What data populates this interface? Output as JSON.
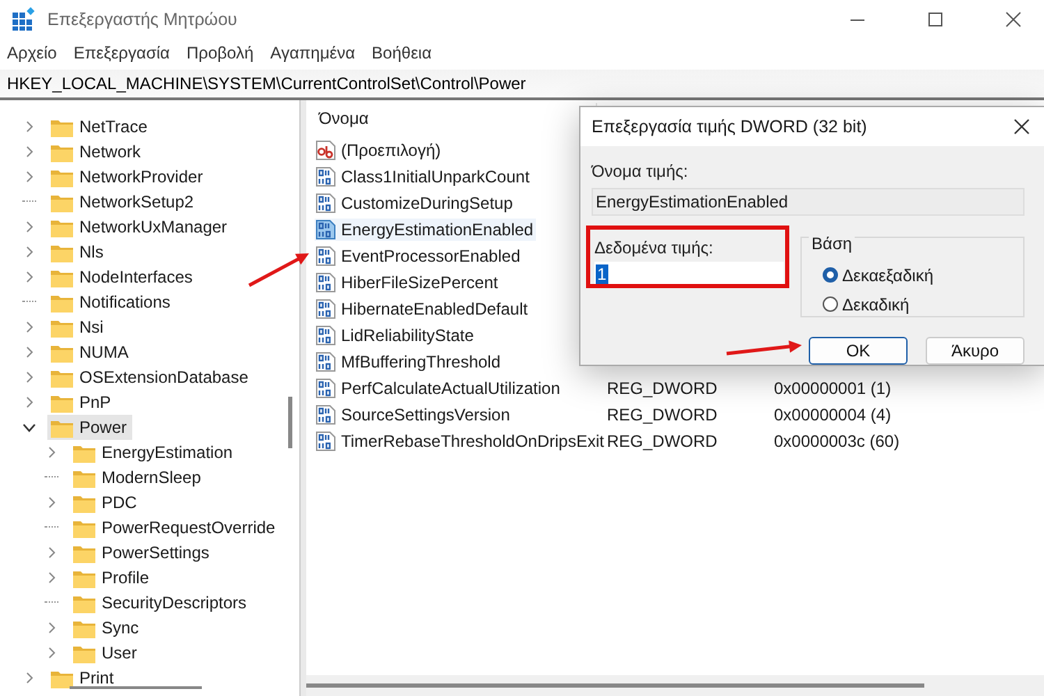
{
  "window": {
    "title": "Επεξεργαστής Μητρώου"
  },
  "menu": [
    "Αρχείο",
    "Επεξεργασία",
    "Προβολή",
    "Αγαπημένα",
    "Βοήθεια"
  ],
  "address": "HKEY_LOCAL_MACHINE\\SYSTEM\\CurrentControlSet\\Control\\Power",
  "tree": [
    {
      "label": "NetTrace",
      "has_children": true,
      "expanded": false,
      "selected": false
    },
    {
      "label": "Network",
      "has_children": true,
      "expanded": false,
      "selected": false
    },
    {
      "label": "NetworkProvider",
      "has_children": true,
      "expanded": false,
      "selected": false
    },
    {
      "label": "NetworkSetup2",
      "has_children": false,
      "selected": false
    },
    {
      "label": "NetworkUxManager",
      "has_children": true,
      "expanded": false,
      "selected": false
    },
    {
      "label": "Nls",
      "has_children": true,
      "expanded": false,
      "selected": false
    },
    {
      "label": "NodeInterfaces",
      "has_children": true,
      "expanded": false,
      "selected": false
    },
    {
      "label": "Notifications",
      "has_children": false,
      "selected": false
    },
    {
      "label": "Nsi",
      "has_children": true,
      "expanded": false,
      "selected": false
    },
    {
      "label": "NUMA",
      "has_children": true,
      "expanded": false,
      "selected": false
    },
    {
      "label": "OSExtensionDatabase",
      "has_children": true,
      "expanded": false,
      "selected": false
    },
    {
      "label": "PnP",
      "has_children": true,
      "expanded": false,
      "selected": false
    },
    {
      "label": "Power",
      "has_children": true,
      "expanded": true,
      "selected": true,
      "children": [
        {
          "label": "EnergyEstimation",
          "has_children": true,
          "expanded": false,
          "selected": false
        },
        {
          "label": "ModernSleep",
          "has_children": false,
          "selected": false
        },
        {
          "label": "PDC",
          "has_children": true,
          "expanded": false,
          "selected": false
        },
        {
          "label": "PowerRequestOverride",
          "has_children": false,
          "selected": false
        },
        {
          "label": "PowerSettings",
          "has_children": true,
          "expanded": false,
          "selected": false
        },
        {
          "label": "Profile",
          "has_children": true,
          "expanded": false,
          "selected": false
        },
        {
          "label": "SecurityDescriptors",
          "has_children": false,
          "selected": false
        },
        {
          "label": "Sync",
          "has_children": true,
          "expanded": false,
          "selected": false
        },
        {
          "label": "User",
          "has_children": true,
          "expanded": false,
          "selected": false
        }
      ]
    },
    {
      "label": "Print",
      "has_children": true,
      "expanded": false,
      "selected": false
    }
  ],
  "values": {
    "columns": [
      "Όνομα"
    ],
    "rows": [
      {
        "name": "(Προεπιλογή)",
        "kind": "string",
        "selected": false
      },
      {
        "name": "Class1InitialUnparkCount",
        "kind": "dword",
        "selected": false
      },
      {
        "name": "CustomizeDuringSetup",
        "kind": "dword",
        "selected": false
      },
      {
        "name": "EnergyEstimationEnabled",
        "kind": "dword",
        "selected": true
      },
      {
        "name": "EventProcessorEnabled",
        "kind": "dword",
        "selected": false
      },
      {
        "name": "HiberFileSizePercent",
        "kind": "dword",
        "selected": false
      },
      {
        "name": "HibernateEnabledDefault",
        "kind": "dword",
        "selected": false
      },
      {
        "name": "LidReliabilityState",
        "kind": "dword",
        "selected": false
      },
      {
        "name": "MfBufferingThreshold",
        "kind": "dword",
        "selected": false
      },
      {
        "name": "PerfCalculateActualUtilization",
        "kind": "dword",
        "selected": false,
        "type": "REG_DWORD",
        "data": "0x00000001 (1)"
      },
      {
        "name": "SourceSettingsVersion",
        "kind": "dword",
        "selected": false,
        "type": "REG_DWORD",
        "data": "0x00000004 (4)"
      },
      {
        "name": "TimerRebaseThresholdOnDripsExit",
        "kind": "dword",
        "selected": false,
        "type": "REG_DWORD",
        "data": "0x0000003c (60)"
      }
    ]
  },
  "dialog": {
    "title": "Επεξεργασία τιμής DWORD (32 bit)",
    "name_label": "Όνομα τιμής:",
    "name_value": "EnergyEstimationEnabled",
    "data_label": "Δεδομένα τιμής:",
    "data_value": "1",
    "base": {
      "title": "Βάση",
      "options": [
        {
          "label": "Δεκαεξαδική",
          "selected": true
        },
        {
          "label": "Δεκαδική",
          "selected": false
        }
      ]
    },
    "buttons": [
      {
        "label": "OK",
        "default": true
      },
      {
        "label": "Άκυρο",
        "default": false
      }
    ]
  }
}
